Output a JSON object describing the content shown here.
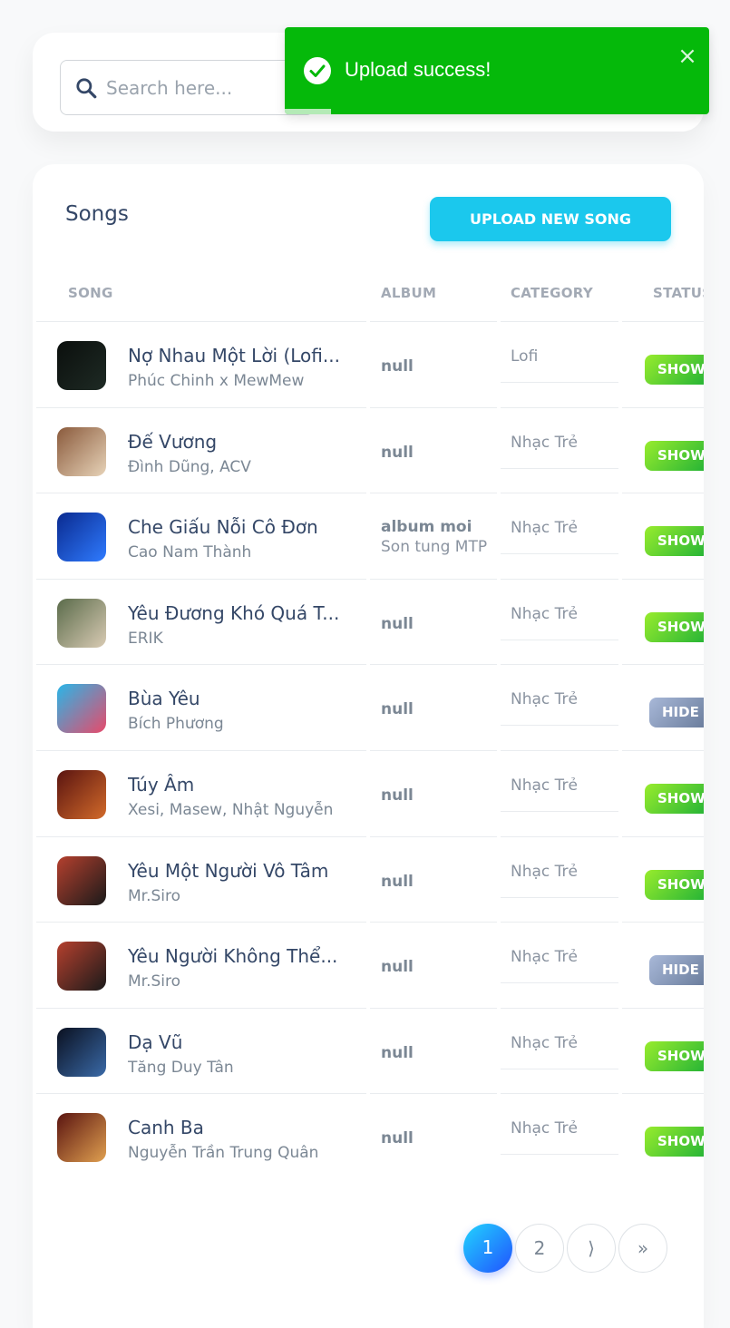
{
  "search": {
    "placeholder": "Search here..."
  },
  "toast": {
    "message": "Upload success!",
    "close_label": "×",
    "progress": 0.11
  },
  "songs_card": {
    "title": "Songs",
    "upload_label": "UPLOAD NEW SONG"
  },
  "columns": {
    "song": "SONG",
    "album": "ALBUM",
    "category": "CATEGORY",
    "status": "STATUS"
  },
  "songs": [
    {
      "name": "Nợ Nhau Một Lời (Lofi...",
      "artist": "Phúc Chinh x MewMew",
      "album": "null",
      "album_artist": "",
      "category": "Lofi",
      "status": "SHOW",
      "art": [
        "#0b0f0d",
        "#1e2a24"
      ]
    },
    {
      "name": "Đế Vương",
      "artist": "Đình Dũng, ACV",
      "album": "null",
      "album_artist": "",
      "category": "Nhạc Trẻ",
      "status": "SHOW",
      "art": [
        "#8a5a3c",
        "#e7d3b8"
      ]
    },
    {
      "name": "Che Giấu Nỗi Cô Đơn",
      "artist": "Cao Nam Thành",
      "album": "album moi",
      "album_artist": "Son tung MTP",
      "category": "Nhạc Trẻ",
      "status": "SHOW",
      "art": [
        "#0a2a8f",
        "#2f7bff"
      ]
    },
    {
      "name": "Yêu Đương Khó Quá T...",
      "artist": "ERIK",
      "album": "null",
      "album_artist": "",
      "category": "Nhạc Trẻ",
      "status": "SHOW",
      "art": [
        "#5a6b4a",
        "#d9cbb4"
      ]
    },
    {
      "name": "Bùa Yêu",
      "artist": "Bích Phương",
      "album": "null",
      "album_artist": "",
      "category": "Nhạc Trẻ",
      "status": "HIDE",
      "art": [
        "#29b6e8",
        "#e84a6a"
      ]
    },
    {
      "name": "Túy Âm",
      "artist": "Xesi, Masew, Nhật Nguyễn",
      "album": "null",
      "album_artist": "",
      "category": "Nhạc Trẻ",
      "status": "SHOW",
      "art": [
        "#5a1410",
        "#d26a2a"
      ]
    },
    {
      "name": "Yêu Một Người Vô Tâm",
      "artist": "Mr.Siro",
      "album": "null",
      "album_artist": "",
      "category": "Nhạc Trẻ",
      "status": "SHOW",
      "art": [
        "#b5402e",
        "#1a1a1a"
      ]
    },
    {
      "name": "Yêu Người Không Thể...",
      "artist": "Mr.Siro",
      "album": "null",
      "album_artist": "",
      "category": "Nhạc Trẻ",
      "status": "HIDE",
      "art": [
        "#b5402e",
        "#1a1a1a"
      ]
    },
    {
      "name": "Dạ Vũ",
      "artist": "Tăng Duy Tân",
      "album": "null",
      "album_artist": "",
      "category": "Nhạc Trẻ",
      "status": "SHOW",
      "art": [
        "#0a1020",
        "#3a6aa8"
      ]
    },
    {
      "name": "Canh Ba",
      "artist": "Nguyễn Trần Trung Quân",
      "album": "null",
      "album_artist": "",
      "category": "Nhạc Trẻ",
      "status": "SHOW",
      "art": [
        "#5a1410",
        "#e0a050"
      ]
    }
  ],
  "pagination": {
    "pages": [
      "1",
      "2"
    ],
    "next": "⟩",
    "last": "»",
    "current": "1"
  }
}
